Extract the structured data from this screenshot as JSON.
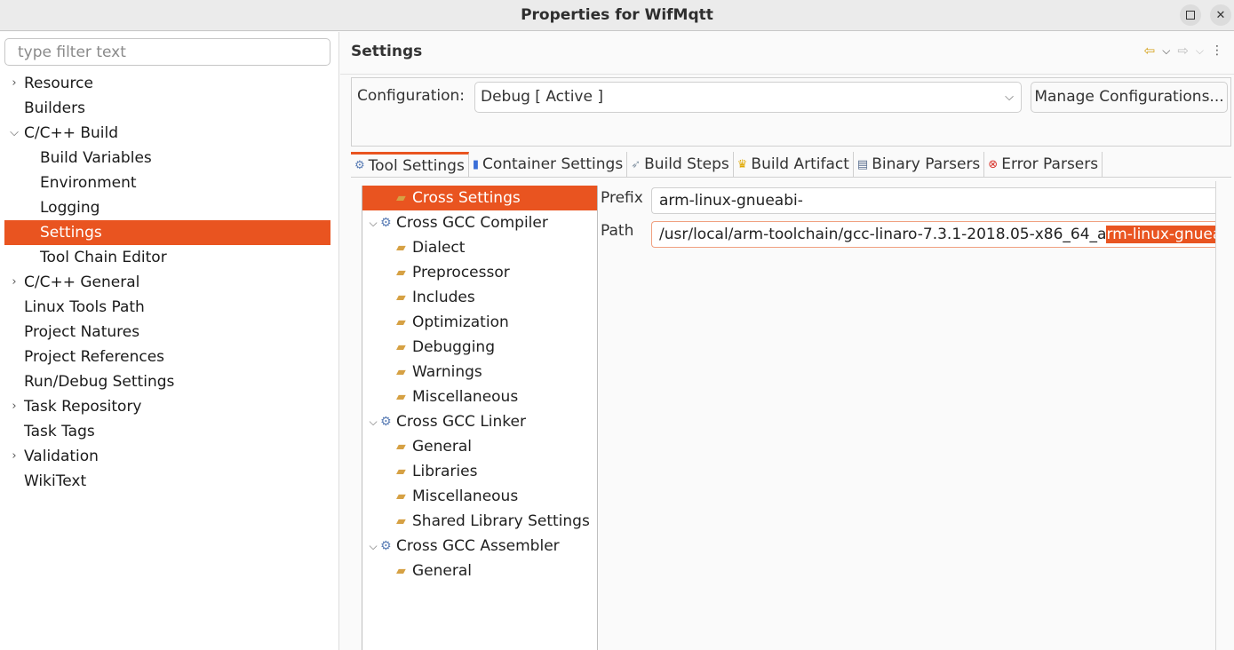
{
  "window": {
    "title": "Properties for WifMqtt",
    "maximize_icon": "maximize-icon",
    "close_icon": "close-icon"
  },
  "left": {
    "filter_placeholder": "type filter text",
    "filter_value": "",
    "tree": [
      {
        "label": "Resource",
        "level": 0,
        "expander": "collapsed"
      },
      {
        "label": "Builders",
        "level": 0,
        "expander": "none"
      },
      {
        "label": "C/C++ Build",
        "level": 0,
        "expander": "expanded"
      },
      {
        "label": "Build Variables",
        "level": 1,
        "expander": "none"
      },
      {
        "label": "Environment",
        "level": 1,
        "expander": "none"
      },
      {
        "label": "Logging",
        "level": 1,
        "expander": "none"
      },
      {
        "label": "Settings",
        "level": 1,
        "expander": "none",
        "selected": true
      },
      {
        "label": "Tool Chain Editor",
        "level": 1,
        "expander": "none"
      },
      {
        "label": "C/C++ General",
        "level": 0,
        "expander": "collapsed"
      },
      {
        "label": "Linux Tools Path",
        "level": 0,
        "expander": "none"
      },
      {
        "label": "Project Natures",
        "level": 0,
        "expander": "none"
      },
      {
        "label": "Project References",
        "level": 0,
        "expander": "none"
      },
      {
        "label": "Run/Debug Settings",
        "level": 0,
        "expander": "none"
      },
      {
        "label": "Task Repository",
        "level": 0,
        "expander": "collapsed"
      },
      {
        "label": "Task Tags",
        "level": 0,
        "expander": "none"
      },
      {
        "label": "Validation",
        "level": 0,
        "expander": "collapsed"
      },
      {
        "label": "WikiText",
        "level": 0,
        "expander": "none"
      }
    ]
  },
  "right": {
    "page_title": "Settings",
    "nav": {
      "back_icon": "back-arrow-icon",
      "forward_icon": "forward-arrow-icon",
      "menu_icon": "view-menu-icon"
    },
    "configuration": {
      "label": "Configuration:",
      "selected": "Debug  [ Active ]",
      "manage_button": "Manage Configurations..."
    },
    "tabs": [
      {
        "label": "Tool Settings",
        "icon": "tool-settings-icon",
        "active": true
      },
      {
        "label": "Container Settings",
        "icon": "container-icon",
        "active": false
      },
      {
        "label": "Build Steps",
        "icon": "build-steps-icon",
        "active": false
      },
      {
        "label": "Build Artifact",
        "icon": "trophy-icon",
        "active": false
      },
      {
        "label": "Binary Parsers",
        "icon": "binary-icon",
        "active": false
      },
      {
        "label": "Error Parsers",
        "icon": "error-icon",
        "active": false
      }
    ],
    "tool_tree": [
      {
        "label": "Cross Settings",
        "level": 1,
        "icon": "folder-settings-icon",
        "selected": true,
        "expander": "none"
      },
      {
        "label": "Cross GCC Compiler",
        "level": 0,
        "icon": "tool-gear-icon",
        "expander": "expanded"
      },
      {
        "label": "Dialect",
        "level": 1,
        "icon": "folder-settings-icon",
        "expander": "none"
      },
      {
        "label": "Preprocessor",
        "level": 1,
        "icon": "folder-settings-icon",
        "expander": "none"
      },
      {
        "label": "Includes",
        "level": 1,
        "icon": "folder-settings-icon",
        "expander": "none"
      },
      {
        "label": "Optimization",
        "level": 1,
        "icon": "folder-settings-icon",
        "expander": "none"
      },
      {
        "label": "Debugging",
        "level": 1,
        "icon": "folder-settings-icon",
        "expander": "none"
      },
      {
        "label": "Warnings",
        "level": 1,
        "icon": "folder-settings-icon",
        "expander": "none"
      },
      {
        "label": "Miscellaneous",
        "level": 1,
        "icon": "folder-settings-icon",
        "expander": "none"
      },
      {
        "label": "Cross GCC Linker",
        "level": 0,
        "icon": "tool-gear-icon",
        "expander": "expanded"
      },
      {
        "label": "General",
        "level": 1,
        "icon": "folder-settings-icon",
        "expander": "none"
      },
      {
        "label": "Libraries",
        "level": 1,
        "icon": "folder-settings-icon",
        "expander": "none"
      },
      {
        "label": "Miscellaneous",
        "level": 1,
        "icon": "folder-settings-icon",
        "expander": "none"
      },
      {
        "label": "Shared Library Settings",
        "level": 1,
        "icon": "folder-settings-icon",
        "expander": "none"
      },
      {
        "label": "Cross GCC Assembler",
        "level": 0,
        "icon": "tool-gear-icon",
        "expander": "expanded"
      },
      {
        "label": "General",
        "level": 1,
        "icon": "folder-settings-icon",
        "expander": "none"
      }
    ],
    "fields": {
      "prefix_label": "Prefix",
      "prefix_value": "arm-linux-gnueabi-",
      "path_label": "Path",
      "path_value_plain": "/usr/local/arm-toolchain/gcc-linaro-7.3.1-2018.05-x86_64_a",
      "path_value_selected": "rm-linux-gnueab"
    }
  },
  "colors": {
    "accent": "#e95420",
    "selection_text": "#ffffff"
  }
}
